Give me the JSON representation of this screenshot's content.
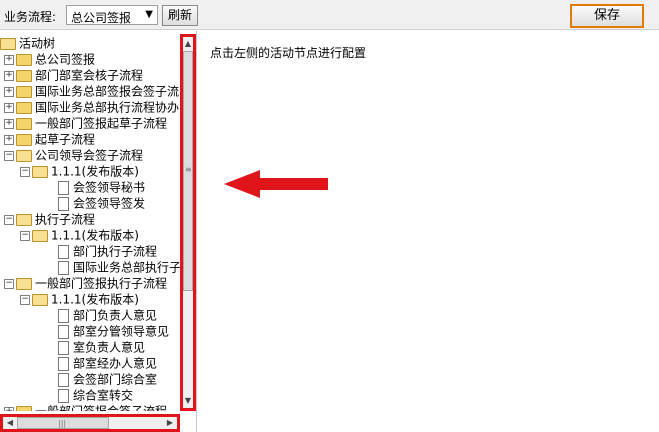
{
  "toolbar": {
    "process_label": "业务流程:",
    "process_select_value": "总公司签报",
    "refresh_label": "刷新",
    "save_label": "保存"
  },
  "tree": {
    "root": "活动树",
    "items": [
      {
        "level": 1,
        "type": "folder",
        "expanded": false,
        "label": "总公司签报"
      },
      {
        "level": 1,
        "type": "folder",
        "expanded": false,
        "label": "部门部室会核子流程"
      },
      {
        "level": 1,
        "type": "folder",
        "expanded": false,
        "label": "国际业务总部签报会签子流"
      },
      {
        "level": 1,
        "type": "folder",
        "expanded": false,
        "label": "国际业务总部执行流程协办"
      },
      {
        "level": 1,
        "type": "folder",
        "expanded": false,
        "label": "一般部门签报起草子流程"
      },
      {
        "level": 1,
        "type": "folder",
        "expanded": false,
        "label": "起草子流程"
      },
      {
        "level": 1,
        "type": "folder",
        "expanded": true,
        "label": "公司领导会签子流程"
      },
      {
        "level": 2,
        "type": "folder",
        "expanded": true,
        "label": "1.1.1(发布版本)"
      },
      {
        "level": 3,
        "type": "page",
        "label": "会签领导秘书"
      },
      {
        "level": 3,
        "type": "page",
        "label": "会签领导签发"
      },
      {
        "level": 1,
        "type": "folder",
        "expanded": true,
        "label": "执行子流程"
      },
      {
        "level": 2,
        "type": "folder",
        "expanded": true,
        "label": "1.1.1(发布版本)"
      },
      {
        "level": 3,
        "type": "page",
        "label": "部门执行子流程"
      },
      {
        "level": 3,
        "type": "page",
        "label": "国际业务总部执行子"
      },
      {
        "level": 1,
        "type": "folder",
        "expanded": true,
        "label": "一般部门签报执行子流程"
      },
      {
        "level": 2,
        "type": "folder",
        "expanded": true,
        "label": "1.1.1(发布版本)"
      },
      {
        "level": 3,
        "type": "page",
        "label": "部门负责人意见"
      },
      {
        "level": 3,
        "type": "page",
        "label": "部室分管领导意见"
      },
      {
        "level": 3,
        "type": "page",
        "label": "室负责人意见"
      },
      {
        "level": 3,
        "type": "page",
        "label": "部室经办人意见"
      },
      {
        "level": 3,
        "type": "page",
        "label": "会签部门综合室"
      },
      {
        "level": 3,
        "type": "page",
        "label": "综合室转交"
      },
      {
        "level": 1,
        "type": "folder",
        "expanded": false,
        "label": "一般部门签报会签子流程"
      }
    ]
  },
  "main": {
    "hint": "点击左侧的活动节点进行配置"
  },
  "colors": {
    "highlight": "#e0141b",
    "save_border": "#e07b00"
  }
}
